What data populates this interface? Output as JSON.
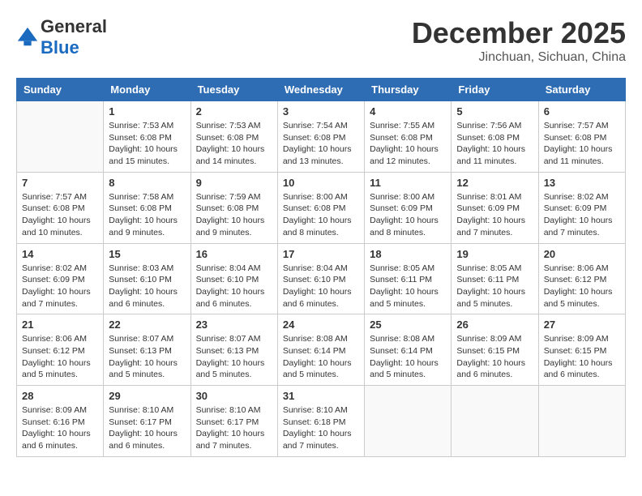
{
  "header": {
    "logo_general": "General",
    "logo_blue": "Blue",
    "month": "December 2025",
    "location": "Jinchuan, Sichuan, China"
  },
  "days_of_week": [
    "Sunday",
    "Monday",
    "Tuesday",
    "Wednesday",
    "Thursday",
    "Friday",
    "Saturday"
  ],
  "weeks": [
    [
      {
        "day": "",
        "info": ""
      },
      {
        "day": "1",
        "info": "Sunrise: 7:53 AM\nSunset: 6:08 PM\nDaylight: 10 hours\nand 15 minutes."
      },
      {
        "day": "2",
        "info": "Sunrise: 7:53 AM\nSunset: 6:08 PM\nDaylight: 10 hours\nand 14 minutes."
      },
      {
        "day": "3",
        "info": "Sunrise: 7:54 AM\nSunset: 6:08 PM\nDaylight: 10 hours\nand 13 minutes."
      },
      {
        "day": "4",
        "info": "Sunrise: 7:55 AM\nSunset: 6:08 PM\nDaylight: 10 hours\nand 12 minutes."
      },
      {
        "day": "5",
        "info": "Sunrise: 7:56 AM\nSunset: 6:08 PM\nDaylight: 10 hours\nand 11 minutes."
      },
      {
        "day": "6",
        "info": "Sunrise: 7:57 AM\nSunset: 6:08 PM\nDaylight: 10 hours\nand 11 minutes."
      }
    ],
    [
      {
        "day": "7",
        "info": "Sunrise: 7:57 AM\nSunset: 6:08 PM\nDaylight: 10 hours\nand 10 minutes."
      },
      {
        "day": "8",
        "info": "Sunrise: 7:58 AM\nSunset: 6:08 PM\nDaylight: 10 hours\nand 9 minutes."
      },
      {
        "day": "9",
        "info": "Sunrise: 7:59 AM\nSunset: 6:08 PM\nDaylight: 10 hours\nand 9 minutes."
      },
      {
        "day": "10",
        "info": "Sunrise: 8:00 AM\nSunset: 6:08 PM\nDaylight: 10 hours\nand 8 minutes."
      },
      {
        "day": "11",
        "info": "Sunrise: 8:00 AM\nSunset: 6:09 PM\nDaylight: 10 hours\nand 8 minutes."
      },
      {
        "day": "12",
        "info": "Sunrise: 8:01 AM\nSunset: 6:09 PM\nDaylight: 10 hours\nand 7 minutes."
      },
      {
        "day": "13",
        "info": "Sunrise: 8:02 AM\nSunset: 6:09 PM\nDaylight: 10 hours\nand 7 minutes."
      }
    ],
    [
      {
        "day": "14",
        "info": "Sunrise: 8:02 AM\nSunset: 6:09 PM\nDaylight: 10 hours\nand 7 minutes."
      },
      {
        "day": "15",
        "info": "Sunrise: 8:03 AM\nSunset: 6:10 PM\nDaylight: 10 hours\nand 6 minutes."
      },
      {
        "day": "16",
        "info": "Sunrise: 8:04 AM\nSunset: 6:10 PM\nDaylight: 10 hours\nand 6 minutes."
      },
      {
        "day": "17",
        "info": "Sunrise: 8:04 AM\nSunset: 6:10 PM\nDaylight: 10 hours\nand 6 minutes."
      },
      {
        "day": "18",
        "info": "Sunrise: 8:05 AM\nSunset: 6:11 PM\nDaylight: 10 hours\nand 5 minutes."
      },
      {
        "day": "19",
        "info": "Sunrise: 8:05 AM\nSunset: 6:11 PM\nDaylight: 10 hours\nand 5 minutes."
      },
      {
        "day": "20",
        "info": "Sunrise: 8:06 AM\nSunset: 6:12 PM\nDaylight: 10 hours\nand 5 minutes."
      }
    ],
    [
      {
        "day": "21",
        "info": "Sunrise: 8:06 AM\nSunset: 6:12 PM\nDaylight: 10 hours\nand 5 minutes."
      },
      {
        "day": "22",
        "info": "Sunrise: 8:07 AM\nSunset: 6:13 PM\nDaylight: 10 hours\nand 5 minutes."
      },
      {
        "day": "23",
        "info": "Sunrise: 8:07 AM\nSunset: 6:13 PM\nDaylight: 10 hours\nand 5 minutes."
      },
      {
        "day": "24",
        "info": "Sunrise: 8:08 AM\nSunset: 6:14 PM\nDaylight: 10 hours\nand 5 minutes."
      },
      {
        "day": "25",
        "info": "Sunrise: 8:08 AM\nSunset: 6:14 PM\nDaylight: 10 hours\nand 5 minutes."
      },
      {
        "day": "26",
        "info": "Sunrise: 8:09 AM\nSunset: 6:15 PM\nDaylight: 10 hours\nand 6 minutes."
      },
      {
        "day": "27",
        "info": "Sunrise: 8:09 AM\nSunset: 6:15 PM\nDaylight: 10 hours\nand 6 minutes."
      }
    ],
    [
      {
        "day": "28",
        "info": "Sunrise: 8:09 AM\nSunset: 6:16 PM\nDaylight: 10 hours\nand 6 minutes."
      },
      {
        "day": "29",
        "info": "Sunrise: 8:10 AM\nSunset: 6:17 PM\nDaylight: 10 hours\nand 6 minutes."
      },
      {
        "day": "30",
        "info": "Sunrise: 8:10 AM\nSunset: 6:17 PM\nDaylight: 10 hours\nand 7 minutes."
      },
      {
        "day": "31",
        "info": "Sunrise: 8:10 AM\nSunset: 6:18 PM\nDaylight: 10 hours\nand 7 minutes."
      },
      {
        "day": "",
        "info": ""
      },
      {
        "day": "",
        "info": ""
      },
      {
        "day": "",
        "info": ""
      }
    ]
  ]
}
